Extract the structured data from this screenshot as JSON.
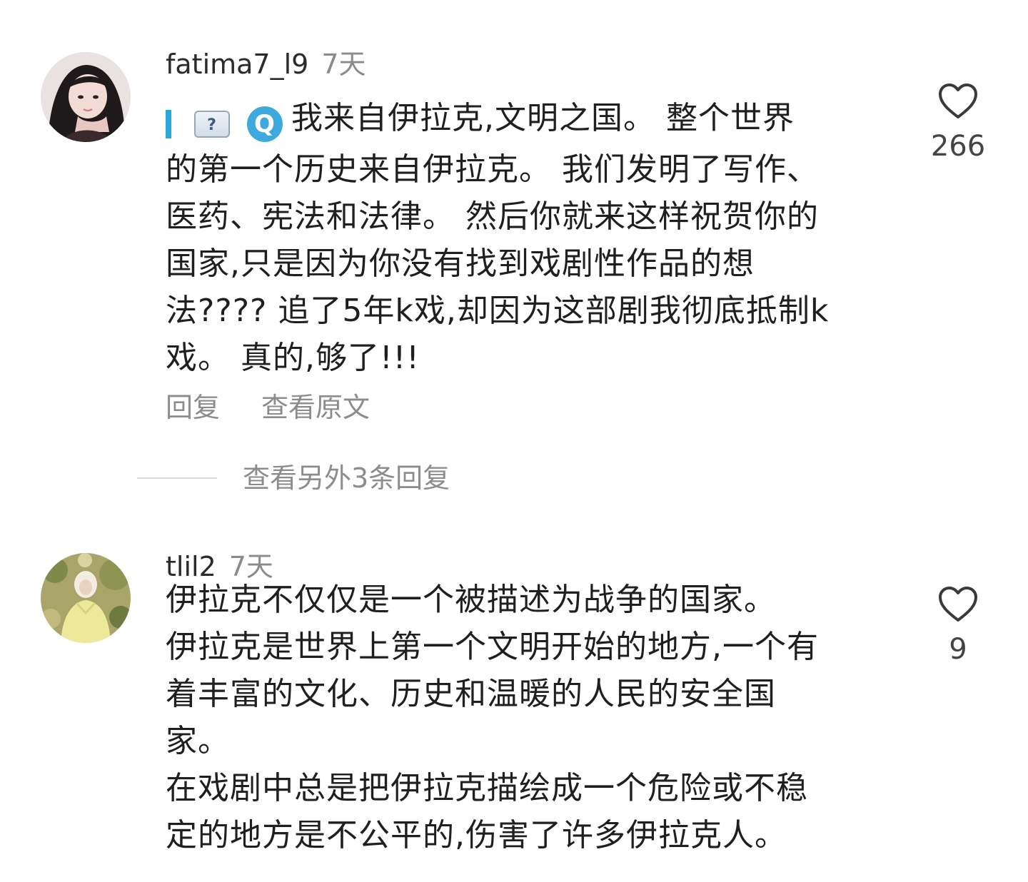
{
  "comments": [
    {
      "username": "fatima7_l9",
      "time": "7天",
      "emoji_flag_text": "?",
      "emoji_q_text": "Q",
      "text_lines": [
        "我来自伊拉克,文明之国。 整个世界",
        "的第一个历史来自伊拉克。 我们发明了写作、",
        "医药、宪法和法律。 然后你就来这样祝贺你的",
        "国家,只是因为你没有找到戏剧性作品的想",
        "法???? 追了5年k戏,却因为这部剧我彻底抵制k",
        "戏。 真的,够了!!!"
      ],
      "reply_label": "回复",
      "view_original_label": "查看原文",
      "more_replies_label": "查看另外3条回复",
      "like_count": "266"
    },
    {
      "username": "tlil2",
      "time": "7天",
      "text_lines": [
        "伊拉克不仅仅是一个被描述为战争的国家。",
        "伊拉克是世界上第一个文明开始的地方,一个有",
        "着丰富的文化、历史和温暖的人民的安全国",
        "家。",
        "在戏剧中总是把伊拉克描绘成一个危险或不稳",
        "定的地方是不公平的,伤害了许多伊拉克人。"
      ],
      "like_count": "9"
    }
  ]
}
